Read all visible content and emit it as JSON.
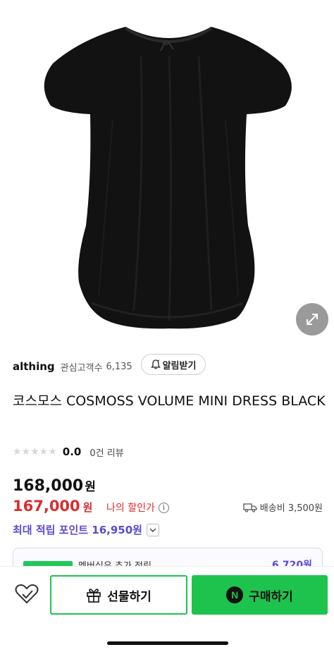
{
  "seller": {
    "name": "althing",
    "follower_label": "관심고객수",
    "follower_count": "6,135",
    "notify_label": "알림받기"
  },
  "product": {
    "title": "코스모스 COSMOSS VOLUME MINI DRESS BLACK",
    "rating_value": "0.0",
    "rating_stars": 0,
    "review_count": "0건 리뷰"
  },
  "price": {
    "original": "168,000",
    "original_unit": "원",
    "sale": "167,000",
    "sale_unit": "원",
    "my_discount_label": "나의 할인가",
    "info_glyph": "i",
    "shipping": "배송비 3,500원"
  },
  "points": {
    "label": "최대 적립 포인트 16,950원"
  },
  "membership": {
    "text": "멤버십은 추가 적립",
    "amount": "6,720원"
  },
  "actions": {
    "gift_label": "선물하기",
    "buy_label": "구매하기",
    "npay_glyph": "N"
  },
  "icons": {
    "expand": "expand-arrows-icon",
    "bell": "bell-icon",
    "info": "info-icon",
    "truck": "truck-icon",
    "chevron": "chevron-down-icon",
    "heart": "heart-icon",
    "gift": "gift-icon",
    "npay": "npay-icon"
  },
  "colors": {
    "sale_red": "#d92d2d",
    "points_purple": "#5a4bcf",
    "buy_green": "#1ec34d"
  }
}
